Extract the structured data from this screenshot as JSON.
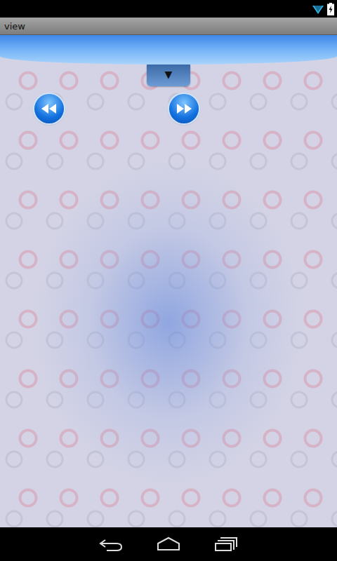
{
  "window": {
    "title": "view"
  },
  "handle": {
    "glyph": "▼"
  }
}
